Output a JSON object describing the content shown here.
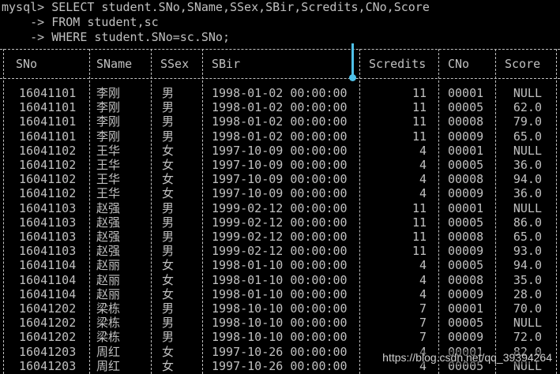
{
  "terminal": {
    "lines": [
      "mysql> SELECT student.SNo,SName,SSex,SBir,Scredits,CNo,Score",
      "    -> FROM student,sc",
      "    -> WHERE student.SNo=sc.SNo;"
    ]
  },
  "table": {
    "headers": [
      "SNo",
      "SName",
      "SSex",
      "SBir",
      "Scredits",
      "CNo",
      "Score"
    ],
    "rows": [
      [
        "16041101",
        "李刚",
        "男",
        "1998-01-02 00:00:00",
        "11",
        "00001",
        "NULL"
      ],
      [
        "16041101",
        "李刚",
        "男",
        "1998-01-02 00:00:00",
        "11",
        "00005",
        "62.0"
      ],
      [
        "16041101",
        "李刚",
        "男",
        "1998-01-02 00:00:00",
        "11",
        "00008",
        "79.0"
      ],
      [
        "16041101",
        "李刚",
        "男",
        "1998-01-02 00:00:00",
        "11",
        "00009",
        "65.0"
      ],
      [
        "16041102",
        "王华",
        "女",
        "1997-10-09 00:00:00",
        "4",
        "00001",
        "NULL"
      ],
      [
        "16041102",
        "王华",
        "女",
        "1997-10-09 00:00:00",
        "4",
        "00005",
        "36.0"
      ],
      [
        "16041102",
        "王华",
        "女",
        "1997-10-09 00:00:00",
        "4",
        "00008",
        "94.0"
      ],
      [
        "16041102",
        "王华",
        "女",
        "1997-10-09 00:00:00",
        "4",
        "00009",
        "36.0"
      ],
      [
        "16041103",
        "赵强",
        "男",
        "1999-02-12 00:00:00",
        "11",
        "00001",
        "NULL"
      ],
      [
        "16041103",
        "赵强",
        "男",
        "1999-02-12 00:00:00",
        "11",
        "00005",
        "86.0"
      ],
      [
        "16041103",
        "赵强",
        "男",
        "1999-02-12 00:00:00",
        "11",
        "00008",
        "65.0"
      ],
      [
        "16041103",
        "赵强",
        "男",
        "1999-02-12 00:00:00",
        "11",
        "00009",
        "93.0"
      ],
      [
        "16041104",
        "赵丽",
        "女",
        "1998-01-10 00:00:00",
        "4",
        "00005",
        "94.0"
      ],
      [
        "16041104",
        "赵丽",
        "女",
        "1998-01-10 00:00:00",
        "4",
        "00008",
        "35.0"
      ],
      [
        "16041104",
        "赵丽",
        "女",
        "1998-01-10 00:00:00",
        "4",
        "00009",
        "28.0"
      ],
      [
        "16041202",
        "梁栋",
        "男",
        "1998-10-10 00:00:00",
        "7",
        "00001",
        "70.0"
      ],
      [
        "16041202",
        "梁栋",
        "男",
        "1998-10-10 00:00:00",
        "7",
        "00005",
        "NULL"
      ],
      [
        "16041202",
        "梁栋",
        "男",
        "1998-10-10 00:00:00",
        "7",
        "00009",
        "72.0"
      ],
      [
        "16041203",
        "周红",
        "女",
        "1997-10-26 00:00:00",
        "4",
        "00001",
        "82.0"
      ],
      [
        "16041203",
        "周红",
        "女",
        "1997-10-26 00:00:00",
        "4",
        "00005",
        "NULL"
      ]
    ]
  },
  "watermark": "https://blog.csdn.net/qq_39394264",
  "colors": {
    "background": "#000000",
    "text": "#c0c0c0",
    "cursor": "#4fc1e9"
  }
}
